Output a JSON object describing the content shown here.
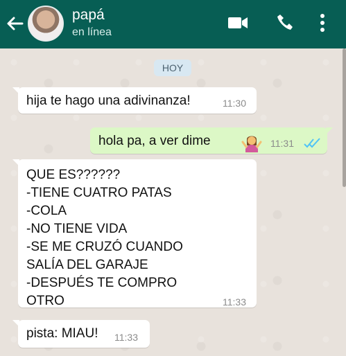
{
  "header": {
    "contact_name": "papá",
    "status": "en línea",
    "icons": [
      "back-arrow-icon",
      "video-call-icon",
      "phone-icon",
      "menu-icon"
    ],
    "colors": {
      "header_bg": "#075e54",
      "outgoing_bubble": "#dcf8c6",
      "incoming_bubble": "#ffffff"
    }
  },
  "chat": {
    "date_label": "HOY",
    "messages": [
      {
        "direction": "incoming",
        "text": "hija te hago una adivinanza!",
        "time": "11:30"
      },
      {
        "direction": "outgoing",
        "text": "hola pa, a ver dime",
        "emoji": "woman-shrugging",
        "time": "11:31",
        "status": "read"
      },
      {
        "direction": "incoming",
        "text": "QUE ES??????\n-TIENE CUATRO PATAS\n-COLA\n-NO TIENE VIDA\n-SE ME CRUZÓ CUANDO\nSALÍA DEL GARAJE\n-DESPUÉS TE COMPRO\nOTRO",
        "time": "11:33"
      },
      {
        "direction": "incoming",
        "text": "pista: MIAU!",
        "time": "11:33"
      }
    ]
  }
}
